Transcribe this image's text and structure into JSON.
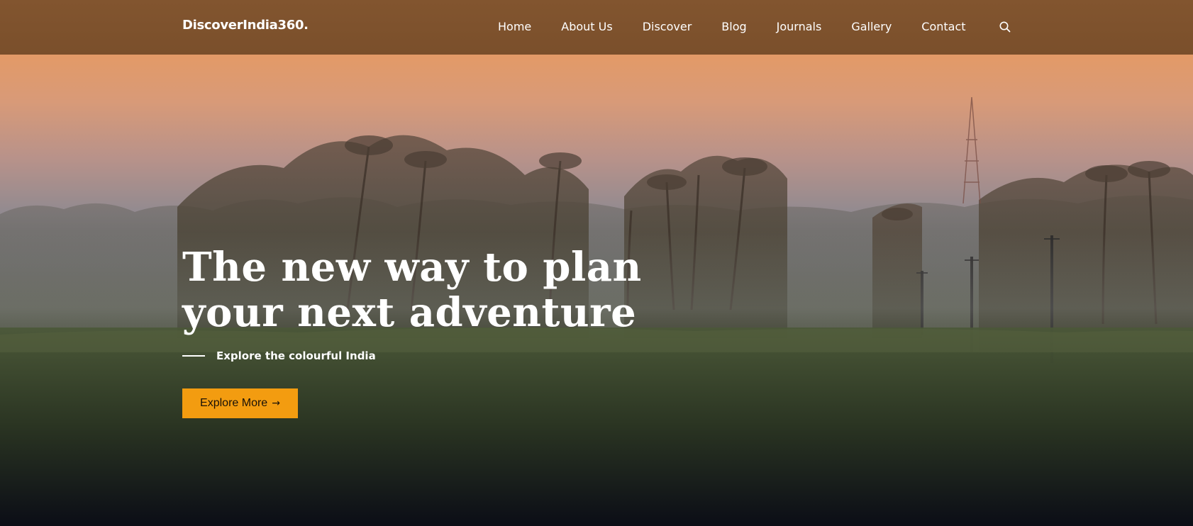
{
  "header": {
    "brand": "DiscoverIndia360.",
    "nav": [
      {
        "label": "Home"
      },
      {
        "label": "About Us"
      },
      {
        "label": "Discover"
      },
      {
        "label": "Blog"
      },
      {
        "label": "Journals"
      },
      {
        "label": "Gallery"
      },
      {
        "label": "Contact"
      }
    ],
    "search_icon": "search-icon"
  },
  "hero": {
    "title_line1": "The new way to plan",
    "title_line2": "your next adventure",
    "tagline": "Explore the colourful India",
    "cta_label": "Explore More",
    "cta_icon": "arrow-right-icon",
    "background": "misty palm trees over paddy field at dawn"
  },
  "colors": {
    "navbar": "#7e522d",
    "accent": "#f39c10",
    "text": "#ffffff"
  }
}
